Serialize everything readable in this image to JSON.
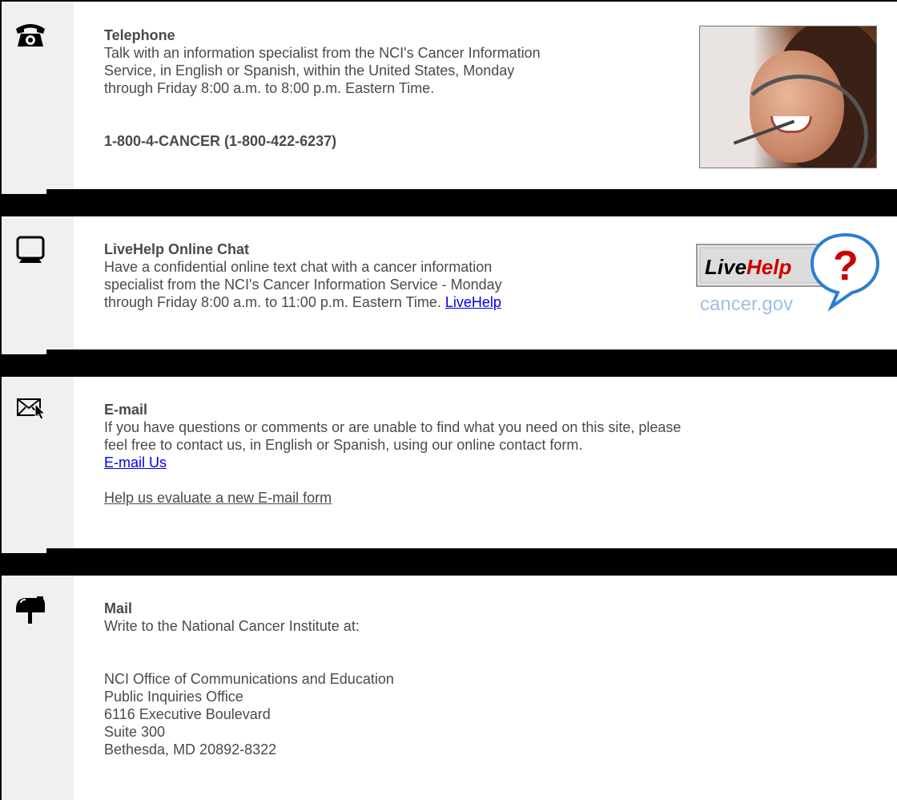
{
  "telephone": {
    "title": "Telephone",
    "lines": [
      "Talk with an information specialist from the NCI's Cancer Information",
      "Service, in English or Spanish, within the United States, Monday",
      "through Friday 8:00 a.m. to 8:00 p.m. Eastern Time."
    ],
    "number": "1-800-4-CANCER (1-800-422-6237)",
    "icon": "telephone-icon"
  },
  "livehelp": {
    "title": "LiveHelp Online Chat",
    "lines": [
      "Have a confidential online text chat with a cancer information",
      "specialist from the NCI's Cancer Information Service - Monday",
      "through Friday 8:00 a.m. to 11:00 p.m. Eastern Time. "
    ],
    "link_label": "LiveHelp",
    "logo_text": "LiveHelp",
    "logo_subtext": "cancer.gov",
    "icon": "computer-monitor-icon"
  },
  "email": {
    "title": "E-mail",
    "lines": [
      "If you have questions or comments or are unable to find what you need on this site, please",
      "feel free to contact us, in English or Spanish, using our online contact form."
    ],
    "link_label": "E-mail Us",
    "evaluate_label": "Help us evaluate a new E-mail form",
    "icon": "envelope-cursor-icon"
  },
  "mail": {
    "title": "Mail",
    "intro": "Write to the National Cancer Institute at:",
    "address": [
      "NCI Office of Communications and Education",
      "Public Inquiries Office",
      "6116 Executive Boulevard",
      "Suite 300",
      "Bethesda, MD 20892-8322"
    ],
    "icon": "mailbox-icon"
  },
  "colors": {
    "text": "#4a4a4a",
    "link": "#0000ee",
    "divider": "#000000",
    "gutter": "#f0f0f0",
    "logo_red": "#cc0000",
    "logo_blue": "#2a7fd0"
  }
}
